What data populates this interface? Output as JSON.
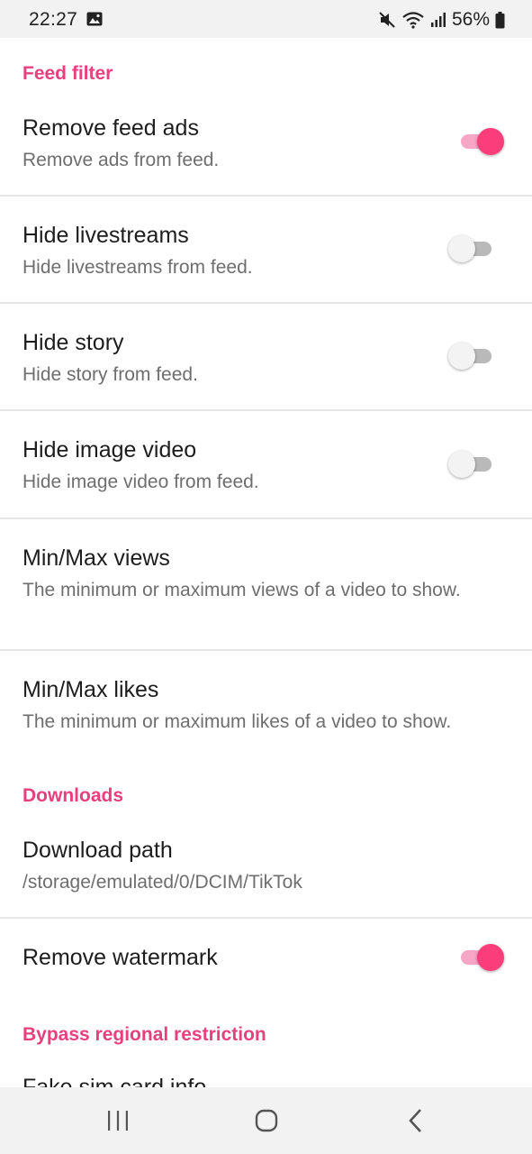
{
  "status_bar": {
    "time": "22:27",
    "battery": "56%",
    "icons": [
      "gallery-icon",
      "mute-icon",
      "wifi-icon",
      "signal-icon",
      "battery-icon"
    ]
  },
  "accent_color": "#e8407e",
  "toggle_on_color": "#fc3d7b",
  "sections": {
    "feed_filter": {
      "title": "Feed filter",
      "items": [
        {
          "title": "Remove feed ads",
          "subtitle": "Remove ads from feed.",
          "toggle": true
        },
        {
          "title": "Hide livestreams",
          "subtitle": "Hide livestreams from feed.",
          "toggle": false
        },
        {
          "title": "Hide story",
          "subtitle": "Hide story from feed.",
          "toggle": false
        },
        {
          "title": "Hide image video",
          "subtitle": "Hide image video from feed.",
          "toggle": false
        },
        {
          "title": "Min/Max views",
          "subtitle": "The minimum or maximum views of a video to show."
        },
        {
          "title": "Min/Max likes",
          "subtitle": "The minimum or maximum likes of a video to show."
        }
      ]
    },
    "downloads": {
      "title": "Downloads",
      "items": [
        {
          "title": "Download path",
          "subtitle": "/storage/emulated/0/DCIM/TikTok"
        },
        {
          "title": "Remove watermark",
          "toggle": true
        }
      ]
    },
    "bypass": {
      "title": "Bypass regional restriction",
      "items": [
        {
          "title": "Fake sim card info"
        }
      ]
    }
  },
  "nav_bar": {
    "buttons": [
      "recent-apps-icon",
      "home-icon",
      "back-icon"
    ]
  }
}
